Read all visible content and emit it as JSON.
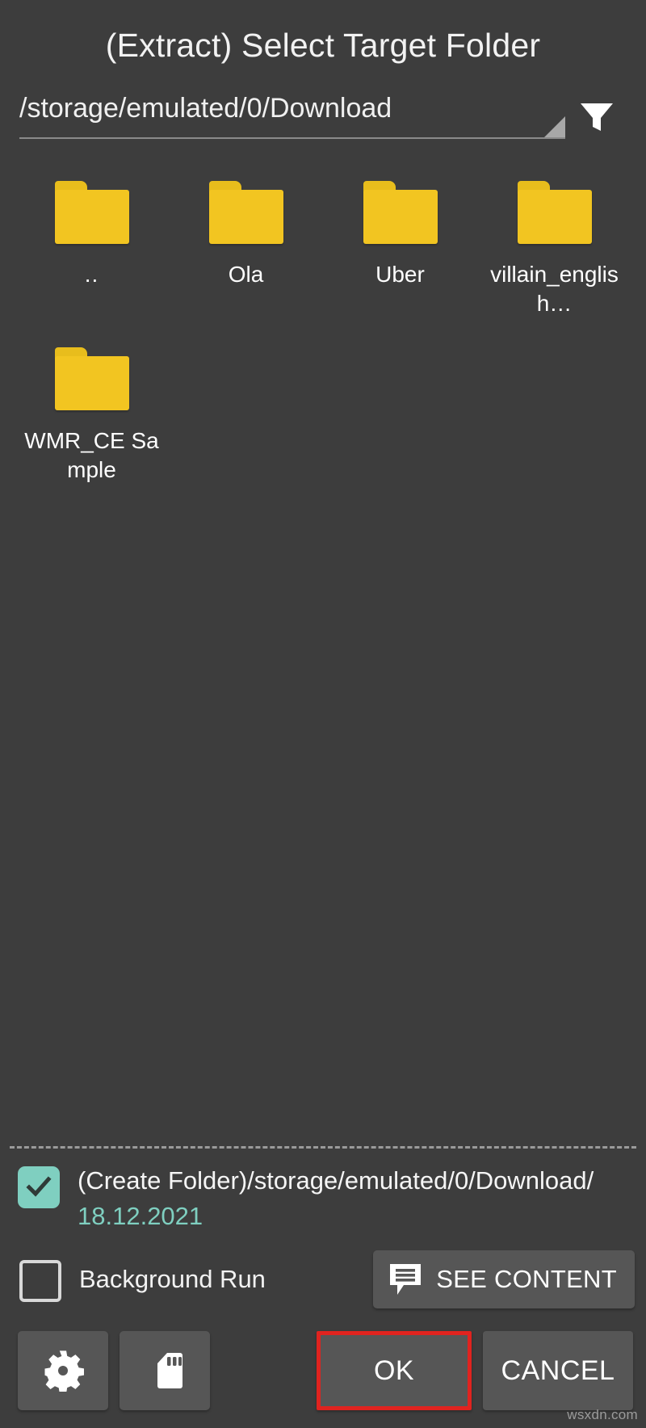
{
  "window": {
    "title": "(Extract) Select Target Folder"
  },
  "path_bar": {
    "value": "/storage/emulated/0/Download",
    "spinner_icon": "dropdown-triangle-icon",
    "filter_icon": "filter-funnel-icon"
  },
  "file_grid": {
    "items": [
      {
        "name": "..",
        "icon": "folder-icon",
        "type": "parent-directory"
      },
      {
        "name": "Ola",
        "icon": "folder-icon",
        "type": "folder"
      },
      {
        "name": "Uber",
        "icon": "folder-icon",
        "type": "folder"
      },
      {
        "name": "villain_englis h…",
        "icon": "folder-icon",
        "type": "folder"
      },
      {
        "name": "WMR_CE Sample",
        "icon": "folder-icon",
        "type": "folder"
      }
    ]
  },
  "options": {
    "create_folder": {
      "checked": true,
      "line1": "(Create Folder)/storage/emulated/0/Download/",
      "line2": "18.12.2021",
      "line2_color": "#7fcfc0"
    },
    "background_run": {
      "checked": false,
      "label": "Background Run"
    },
    "see_content": {
      "label": "SEE CONTENT",
      "icon": "comment-list-icon"
    }
  },
  "action_bar": {
    "settings": {
      "icon": "gear-icon"
    },
    "storage": {
      "icon": "sd-card-icon"
    },
    "ok": {
      "label": "OK",
      "highlighted": true,
      "highlight_color": "#e0231f"
    },
    "cancel": {
      "label": "CANCEL"
    }
  },
  "watermark": {
    "text": "wsxdn.com"
  },
  "colors": {
    "background": "#3d3d3d",
    "folder": "#f2c521",
    "accent_teal": "#7fcfc0",
    "button": "#565656",
    "highlight_red": "#e0231f"
  }
}
